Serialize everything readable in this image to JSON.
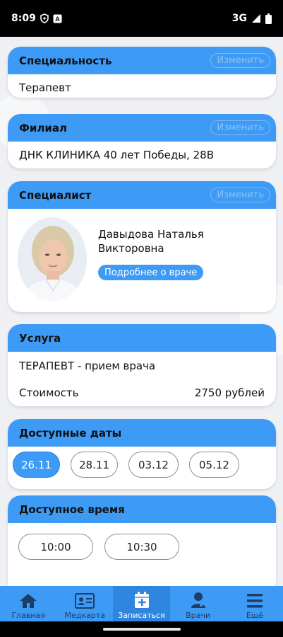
{
  "status_bar": {
    "time": "8:09",
    "network": "3G"
  },
  "change_label": "Изменить",
  "specialty": {
    "title": "Специальность",
    "value": "Терапевт"
  },
  "branch": {
    "title": "Филиал",
    "value": "ДНК КЛИНИКА 40 лет Победы, 28В"
  },
  "specialist": {
    "title": "Специалист",
    "name_line1": "Давыдова Наталья",
    "name_line2": "Викторовна",
    "details_button": "Подробнее о враче"
  },
  "service": {
    "title": "Услуга",
    "name": "ТЕРАПЕВТ - прием врача",
    "cost_label": "Стоимость",
    "cost_value": "2750 рублей"
  },
  "dates": {
    "title": "Доступные даты",
    "items": [
      "26.11",
      "28.11",
      "03.12",
      "05.12"
    ],
    "selected": "26.11"
  },
  "times": {
    "title": "Доступное время",
    "items": [
      "10:00",
      "10:30"
    ]
  },
  "nav": {
    "items": [
      {
        "label": "Главная",
        "icon": "home-icon"
      },
      {
        "label": "Медкарта",
        "icon": "medcard-icon"
      },
      {
        "label": "Записаться",
        "icon": "calendar-plus-icon"
      },
      {
        "label": "Врачи",
        "icon": "doctor-icon"
      },
      {
        "label": "Ещё",
        "icon": "menu-icon"
      }
    ],
    "active": "Записаться"
  }
}
